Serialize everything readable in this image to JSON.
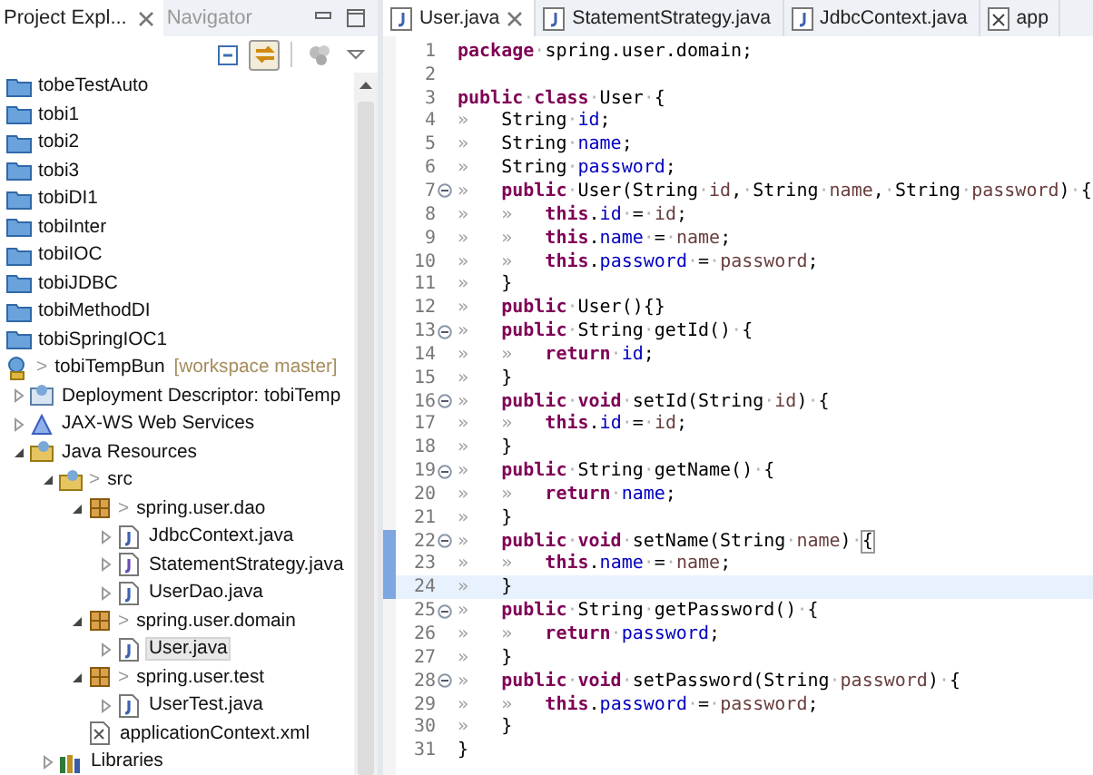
{
  "explorer": {
    "tabs": [
      {
        "label": "Project Expl...",
        "selected": true,
        "closable": true
      },
      {
        "label": "Navigator",
        "selected": false,
        "closable": false
      }
    ],
    "toolbar": [
      {
        "kind": "collapse",
        "selected": false
      },
      {
        "kind": "link",
        "selected": true
      },
      {
        "kind": "spheres",
        "selected": false
      },
      {
        "kind": "menu",
        "selected": false
      }
    ],
    "tree": [
      {
        "label": "tobeTestAuto",
        "kind": "project",
        "selected": false
      },
      {
        "label": "tobi1",
        "kind": "project",
        "selected": false
      },
      {
        "label": "tobi2",
        "kind": "project",
        "selected": false
      },
      {
        "label": "tobi3",
        "kind": "project",
        "selected": false
      },
      {
        "label": "tobiDI1",
        "kind": "project",
        "selected": false
      },
      {
        "label": "tobiInter",
        "kind": "project",
        "selected": false
      },
      {
        "label": "tobiIOC",
        "kind": "project",
        "selected": false
      },
      {
        "label": "tobiJDBC",
        "kind": "project",
        "selected": false
      },
      {
        "label": "tobiMethodDI",
        "kind": "project",
        "selected": false
      },
      {
        "label": "tobiSpringIOC1",
        "kind": "project",
        "selected": false
      },
      {
        "label": "tobiTempBun",
        "prefix": ">",
        "decoration": "[workspace master]",
        "kind": "web-project",
        "selected": false,
        "children": [
          {
            "label": "Deployment Descriptor: tobiTemp",
            "kind": "descriptor",
            "expanded": false,
            "selected": false
          },
          {
            "label": "JAX-WS Web Services",
            "kind": "webservice",
            "expanded": false,
            "selected": false
          },
          {
            "label": "Java Resources",
            "kind": "resources",
            "expanded": true,
            "selected": false,
            "children": [
              {
                "label": "src",
                "prefix": ">",
                "kind": "source",
                "expanded": true,
                "selected": false,
                "children": [
                  {
                    "label": "spring.user.dao",
                    "prefix": ">",
                    "kind": "package",
                    "expanded": true,
                    "selected": false,
                    "children": [
                      {
                        "label": "JdbcContext.java",
                        "kind": "java",
                        "expanded": false,
                        "selected": false
                      },
                      {
                        "label": "StatementStrategy.java",
                        "kind": "interface",
                        "expanded": false,
                        "selected": false
                      },
                      {
                        "label": "UserDao.java",
                        "kind": "java",
                        "expanded": false,
                        "selected": false
                      }
                    ]
                  },
                  {
                    "label": "spring.user.domain",
                    "prefix": ">",
                    "kind": "package",
                    "expanded": true,
                    "selected": false,
                    "children": [
                      {
                        "label": "User.java",
                        "kind": "java",
                        "expanded": false,
                        "selected": true
                      }
                    ]
                  },
                  {
                    "label": "spring.user.test",
                    "prefix": ">",
                    "kind": "package",
                    "expanded": true,
                    "selected": false,
                    "children": [
                      {
                        "label": "UserTest.java",
                        "kind": "java",
                        "expanded": false,
                        "selected": false
                      }
                    ]
                  },
                  {
                    "label": "applicationContext.xml",
                    "kind": "xml",
                    "selected": false
                  }
                ]
              },
              {
                "label": "Libraries",
                "kind": "library",
                "expanded": false,
                "selected": false
              }
            ]
          }
        ]
      }
    ]
  },
  "editor": {
    "tabs": [
      {
        "label": "User.java",
        "kind": "java",
        "selected": true,
        "closable": true
      },
      {
        "label": "StatementStrategy.java",
        "kind": "java",
        "selected": false,
        "closable": false
      },
      {
        "label": "JdbcContext.java",
        "kind": "java",
        "selected": false,
        "closable": false
      },
      {
        "label": "app",
        "kind": "xml",
        "selected": false,
        "closable": false
      }
    ],
    "lines": [
      {
        "number": "1",
        "fold": false,
        "changed": false,
        "current": false,
        "tokens": [
          {
            "t": "package",
            "kind": "kw"
          },
          {
            "t": "·spring.user.domain;",
            "kind": "plain"
          }
        ]
      },
      {
        "number": "2",
        "fold": false,
        "changed": false,
        "current": false
      },
      {
        "number": "3",
        "fold": false,
        "changed": false,
        "current": false,
        "tokens": [
          {
            "t": "public",
            "kind": "kw"
          },
          {
            "t": "·",
            "kind": "plain"
          },
          {
            "t": "class",
            "kind": "kw"
          },
          {
            "t": "·User·{",
            "kind": "plain"
          }
        ]
      },
      {
        "number": "4",
        "fold": false,
        "changed": false,
        "current": false,
        "tokens": [
          {
            "t": "»   ",
            "kind": "ws"
          },
          {
            "t": "String·",
            "kind": "plain"
          },
          {
            "t": "id",
            "kind": "field"
          },
          {
            "t": ";",
            "kind": "plain"
          }
        ]
      },
      {
        "number": "5",
        "fold": false,
        "changed": false,
        "current": false,
        "tokens": [
          {
            "t": "»   ",
            "kind": "ws"
          },
          {
            "t": "String·",
            "kind": "plain"
          },
          {
            "t": "name",
            "kind": "field"
          },
          {
            "t": ";",
            "kind": "plain"
          }
        ]
      },
      {
        "number": "6",
        "fold": false,
        "changed": false,
        "current": false,
        "tokens": [
          {
            "t": "»   ",
            "kind": "ws"
          },
          {
            "t": "String·",
            "kind": "plain"
          },
          {
            "t": "password",
            "kind": "field"
          },
          {
            "t": ";",
            "kind": "plain"
          }
        ]
      },
      {
        "number": "7",
        "fold": true,
        "changed": false,
        "current": false,
        "tokens": [
          {
            "t": "»   ",
            "kind": "ws"
          },
          {
            "t": "public",
            "kind": "kw"
          },
          {
            "t": "·User(String·",
            "kind": "plain"
          },
          {
            "t": "id",
            "kind": "param"
          },
          {
            "t": ",·String·",
            "kind": "plain"
          },
          {
            "t": "name",
            "kind": "param"
          },
          {
            "t": ",·String·",
            "kind": "plain"
          },
          {
            "t": "password",
            "kind": "param"
          },
          {
            "t": ")·{",
            "kind": "plain"
          }
        ]
      },
      {
        "number": "8",
        "fold": false,
        "changed": false,
        "current": false,
        "tokens": [
          {
            "t": "»   »   ",
            "kind": "ws"
          },
          {
            "t": "this",
            "kind": "kw"
          },
          {
            "t": ".",
            "kind": "plain"
          },
          {
            "t": "id",
            "kind": "field"
          },
          {
            "t": "·=·",
            "kind": "plain"
          },
          {
            "t": "id",
            "kind": "param"
          },
          {
            "t": ";",
            "kind": "plain"
          }
        ]
      },
      {
        "number": "9",
        "fold": false,
        "changed": false,
        "current": false,
        "tokens": [
          {
            "t": "»   »   ",
            "kind": "ws"
          },
          {
            "t": "this",
            "kind": "kw"
          },
          {
            "t": ".",
            "kind": "plain"
          },
          {
            "t": "name",
            "kind": "field"
          },
          {
            "t": "·=·",
            "kind": "plain"
          },
          {
            "t": "name",
            "kind": "param"
          },
          {
            "t": ";",
            "kind": "plain"
          }
        ]
      },
      {
        "number": "10",
        "fold": false,
        "changed": false,
        "current": false,
        "tokens": [
          {
            "t": "»   »   ",
            "kind": "ws"
          },
          {
            "t": "this",
            "kind": "kw"
          },
          {
            "t": ".",
            "kind": "plain"
          },
          {
            "t": "password",
            "kind": "field"
          },
          {
            "t": "·=·",
            "kind": "plain"
          },
          {
            "t": "password",
            "kind": "param"
          },
          {
            "t": ";",
            "kind": "plain"
          }
        ]
      },
      {
        "number": "11",
        "fold": false,
        "changed": false,
        "current": false,
        "tokens": [
          {
            "t": "»   ",
            "kind": "ws"
          },
          {
            "t": "}",
            "kind": "plain"
          }
        ]
      },
      {
        "number": "12",
        "fold": false,
        "changed": false,
        "current": false,
        "tokens": [
          {
            "t": "»   ",
            "kind": "ws"
          },
          {
            "t": "public",
            "kind": "kw"
          },
          {
            "t": "·User(){}",
            "kind": "plain"
          }
        ]
      },
      {
        "number": "13",
        "fold": true,
        "changed": false,
        "current": false,
        "tokens": [
          {
            "t": "»   ",
            "kind": "ws"
          },
          {
            "t": "public",
            "kind": "kw"
          },
          {
            "t": "·String·getId()·{",
            "kind": "plain"
          }
        ]
      },
      {
        "number": "14",
        "fold": false,
        "changed": false,
        "current": false,
        "tokens": [
          {
            "t": "»   »   ",
            "kind": "ws"
          },
          {
            "t": "return",
            "kind": "kw"
          },
          {
            "t": "·",
            "kind": "plain"
          },
          {
            "t": "id",
            "kind": "field"
          },
          {
            "t": ";",
            "kind": "plain"
          }
        ]
      },
      {
        "number": "15",
        "fold": false,
        "changed": false,
        "current": false,
        "tokens": [
          {
            "t": "»   ",
            "kind": "ws"
          },
          {
            "t": "}",
            "kind": "plain"
          }
        ]
      },
      {
        "number": "16",
        "fold": true,
        "changed": false,
        "current": false,
        "tokens": [
          {
            "t": "»   ",
            "kind": "ws"
          },
          {
            "t": "public",
            "kind": "kw"
          },
          {
            "t": "·",
            "kind": "plain"
          },
          {
            "t": "void",
            "kind": "kw"
          },
          {
            "t": "·setId(String·",
            "kind": "plain"
          },
          {
            "t": "id",
            "kind": "param"
          },
          {
            "t": ")·{",
            "kind": "plain"
          }
        ]
      },
      {
        "number": "17",
        "fold": false,
        "changed": false,
        "current": false,
        "tokens": [
          {
            "t": "»   »   ",
            "kind": "ws"
          },
          {
            "t": "this",
            "kind": "kw"
          },
          {
            "t": ".",
            "kind": "plain"
          },
          {
            "t": "id",
            "kind": "field"
          },
          {
            "t": "·=·",
            "kind": "plain"
          },
          {
            "t": "id",
            "kind": "param"
          },
          {
            "t": ";",
            "kind": "plain"
          }
        ]
      },
      {
        "number": "18",
        "fold": false,
        "changed": false,
        "current": false,
        "tokens": [
          {
            "t": "»   ",
            "kind": "ws"
          },
          {
            "t": "}",
            "kind": "plain"
          }
        ]
      },
      {
        "number": "19",
        "fold": true,
        "changed": false,
        "current": false,
        "tokens": [
          {
            "t": "»   ",
            "kind": "ws"
          },
          {
            "t": "public",
            "kind": "kw"
          },
          {
            "t": "·String·getName()·{",
            "kind": "plain"
          }
        ]
      },
      {
        "number": "20",
        "fold": false,
        "changed": false,
        "current": false,
        "tokens": [
          {
            "t": "»   »   ",
            "kind": "ws"
          },
          {
            "t": "return",
            "kind": "kw"
          },
          {
            "t": "·",
            "kind": "plain"
          },
          {
            "t": "name",
            "kind": "field"
          },
          {
            "t": ";",
            "kind": "plain"
          }
        ]
      },
      {
        "number": "21",
        "fold": false,
        "changed": false,
        "current": false,
        "tokens": [
          {
            "t": "»   ",
            "kind": "ws"
          },
          {
            "t": "}",
            "kind": "plain"
          }
        ]
      },
      {
        "number": "22",
        "fold": true,
        "changed": true,
        "current": false,
        "tokens": [
          {
            "t": "»   ",
            "kind": "ws"
          },
          {
            "t": "public",
            "kind": "kw"
          },
          {
            "t": "·",
            "kind": "plain"
          },
          {
            "t": "void",
            "kind": "kw"
          },
          {
            "t": "·setName(String·",
            "kind": "plain"
          },
          {
            "t": "name",
            "kind": "param"
          },
          {
            "t": ")·",
            "kind": "plain"
          },
          {
            "t": "{",
            "kind": "bracket"
          }
        ]
      },
      {
        "number": "23",
        "fold": false,
        "changed": true,
        "current": false,
        "tokens": [
          {
            "t": "»   »   ",
            "kind": "ws"
          },
          {
            "t": "this",
            "kind": "kw"
          },
          {
            "t": ".",
            "kind": "plain"
          },
          {
            "t": "name",
            "kind": "field"
          },
          {
            "t": "·=·",
            "kind": "plain"
          },
          {
            "t": "name",
            "kind": "param"
          },
          {
            "t": ";",
            "kind": "plain"
          }
        ]
      },
      {
        "number": "24",
        "fold": false,
        "changed": true,
        "current": true,
        "tokens": [
          {
            "t": "»   ",
            "kind": "ws"
          },
          {
            "t": "}",
            "kind": "plain"
          }
        ]
      },
      {
        "number": "25",
        "fold": true,
        "changed": false,
        "current": false,
        "tokens": [
          {
            "t": "»   ",
            "kind": "ws"
          },
          {
            "t": "public",
            "kind": "kw"
          },
          {
            "t": "·String·getPassword()·{",
            "kind": "plain"
          }
        ]
      },
      {
        "number": "26",
        "fold": false,
        "changed": false,
        "current": false,
        "tokens": [
          {
            "t": "»   »   ",
            "kind": "ws"
          },
          {
            "t": "return",
            "kind": "kw"
          },
          {
            "t": "·",
            "kind": "plain"
          },
          {
            "t": "password",
            "kind": "field"
          },
          {
            "t": ";",
            "kind": "plain"
          }
        ]
      },
      {
        "number": "27",
        "fold": false,
        "changed": false,
        "current": false,
        "tokens": [
          {
            "t": "»   ",
            "kind": "ws"
          },
          {
            "t": "}",
            "kind": "plain"
          }
        ]
      },
      {
        "number": "28",
        "fold": true,
        "changed": false,
        "current": false,
        "tokens": [
          {
            "t": "»   ",
            "kind": "ws"
          },
          {
            "t": "public",
            "kind": "kw"
          },
          {
            "t": "·",
            "kind": "plain"
          },
          {
            "t": "void",
            "kind": "kw"
          },
          {
            "t": "·setPassword(String·",
            "kind": "plain"
          },
          {
            "t": "password",
            "kind": "param"
          },
          {
            "t": ")·{",
            "kind": "plain"
          }
        ]
      },
      {
        "number": "29",
        "fold": false,
        "changed": false,
        "current": false,
        "tokens": [
          {
            "t": "»   »   ",
            "kind": "ws"
          },
          {
            "t": "this",
            "kind": "kw"
          },
          {
            "t": ".",
            "kind": "plain"
          },
          {
            "t": "password",
            "kind": "field"
          },
          {
            "t": "·=·",
            "kind": "plain"
          },
          {
            "t": "password",
            "kind": "param"
          },
          {
            "t": ";",
            "kind": "plain"
          }
        ]
      },
      {
        "number": "30",
        "fold": false,
        "changed": false,
        "current": false,
        "tokens": [
          {
            "t": "»   ",
            "kind": "ws"
          },
          {
            "t": "}",
            "kind": "plain"
          }
        ]
      },
      {
        "number": "31",
        "fold": false,
        "changed": false,
        "current": false,
        "tokens": [
          {
            "t": "}",
            "kind": "plain"
          }
        ]
      }
    ]
  }
}
